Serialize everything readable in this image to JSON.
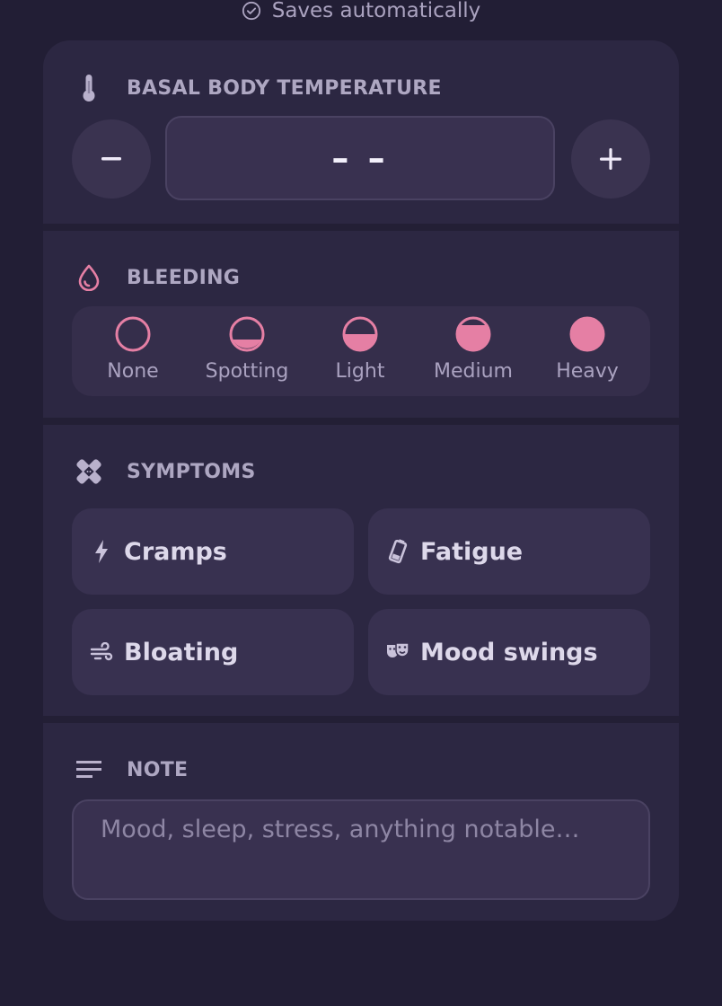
{
  "save_status": {
    "text": "Saves automatically",
    "icon": "check-circle-icon"
  },
  "temperature": {
    "title": "BASAL BODY TEMPERATURE",
    "icon": "thermometer-icon",
    "value": "– –",
    "decrement_label": "–",
    "increment_label": "+"
  },
  "bleeding": {
    "title": "BLEEDING",
    "icon": "drop-icon",
    "options": [
      {
        "label": "None",
        "fill_level": 0
      },
      {
        "label": "Spotting",
        "fill_level": 0.3
      },
      {
        "label": "Light",
        "fill_level": 0.5
      },
      {
        "label": "Medium",
        "fill_level": 0.8
      },
      {
        "label": "Heavy",
        "fill_level": 1
      }
    ],
    "accent_color": "#e57fa4"
  },
  "symptoms": {
    "title": "SYMPTOMS",
    "icon": "bandage-icon",
    "items": [
      {
        "label": "Cramps",
        "icon": "lightning-icon"
      },
      {
        "label": "Fatigue",
        "icon": "battery-low-icon"
      },
      {
        "label": "Bloating",
        "icon": "wind-icon"
      },
      {
        "label": "Mood swings",
        "icon": "theater-masks-icon"
      }
    ]
  },
  "note": {
    "title": "NOTE",
    "icon": "notes-lines-icon",
    "placeholder": "Mood, sleep, stress, anything notable…",
    "value": ""
  },
  "colors": {
    "background": "#221e35",
    "card": "#2c2742",
    "accent_pink": "#e57fa4",
    "text_muted": "#aea7c2"
  }
}
